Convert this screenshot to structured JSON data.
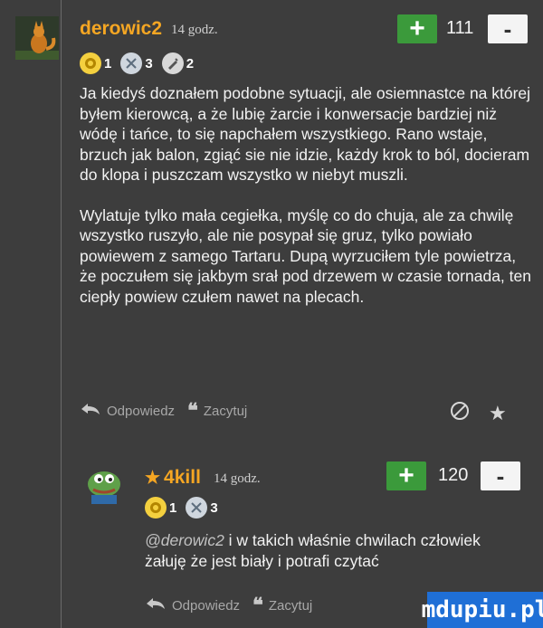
{
  "comment1": {
    "username": "derowic2",
    "time": "14 godz.",
    "score": "111",
    "plus_label": "+",
    "minus_label": "-",
    "badges": [
      {
        "icon": "gold-medal-icon",
        "count": "1"
      },
      {
        "icon": "silver-medal-icon",
        "count": "3"
      },
      {
        "icon": "pen-badge-icon",
        "count": "2"
      }
    ],
    "paragraphs": [
      "Ja kiedyś doznałem podobne sytuacji, ale osiemnastce na której byłem kierowcą, a że lubię żarcie i konwersacje bardziej niż wódę i tańce, to się napchałem wszystkiego. Rano wstaje, brzuch jak balon, zgiąć sie nie idzie, każdy krok to ból, docieram do klopa i puszczam wszystko w niebyt muszli.",
      "Wylatuje tylko mała cegiełka, myślę co do chuja, ale za chwilę wszystko ruszyło, ale nie posypał się gruz, tylko powiało powiewem z samego Tartaru. Dupą wyrzuciłem tyle powietrza, że poczułem się jakbym srał pod drzewem w czasie tornada, ten ciepły powiew czułem nawet na plecach."
    ],
    "reply_label": "Odpowiedz",
    "quote_label": "Zacytuj"
  },
  "comment2": {
    "username": "4kill",
    "time": "14 godz.",
    "score": "120",
    "plus_label": "+",
    "minus_label": "-",
    "badges": [
      {
        "icon": "gold-medal-icon",
        "count": "1"
      },
      {
        "icon": "silver-medal-icon",
        "count": "3"
      }
    ],
    "mention": "@derowic2",
    "text": " i w takich właśnie chwilach człowiek żałuję że jest biały i potrafi czytać",
    "reply_label": "Odpowiedz",
    "quote_label": "Zacytuj"
  },
  "watermark": "mdupiu.pl",
  "colors": {
    "background": "#3d3d3d",
    "username": "#f5a623",
    "plus": "#3b9a3b",
    "watermark": "#1f6fd6"
  }
}
